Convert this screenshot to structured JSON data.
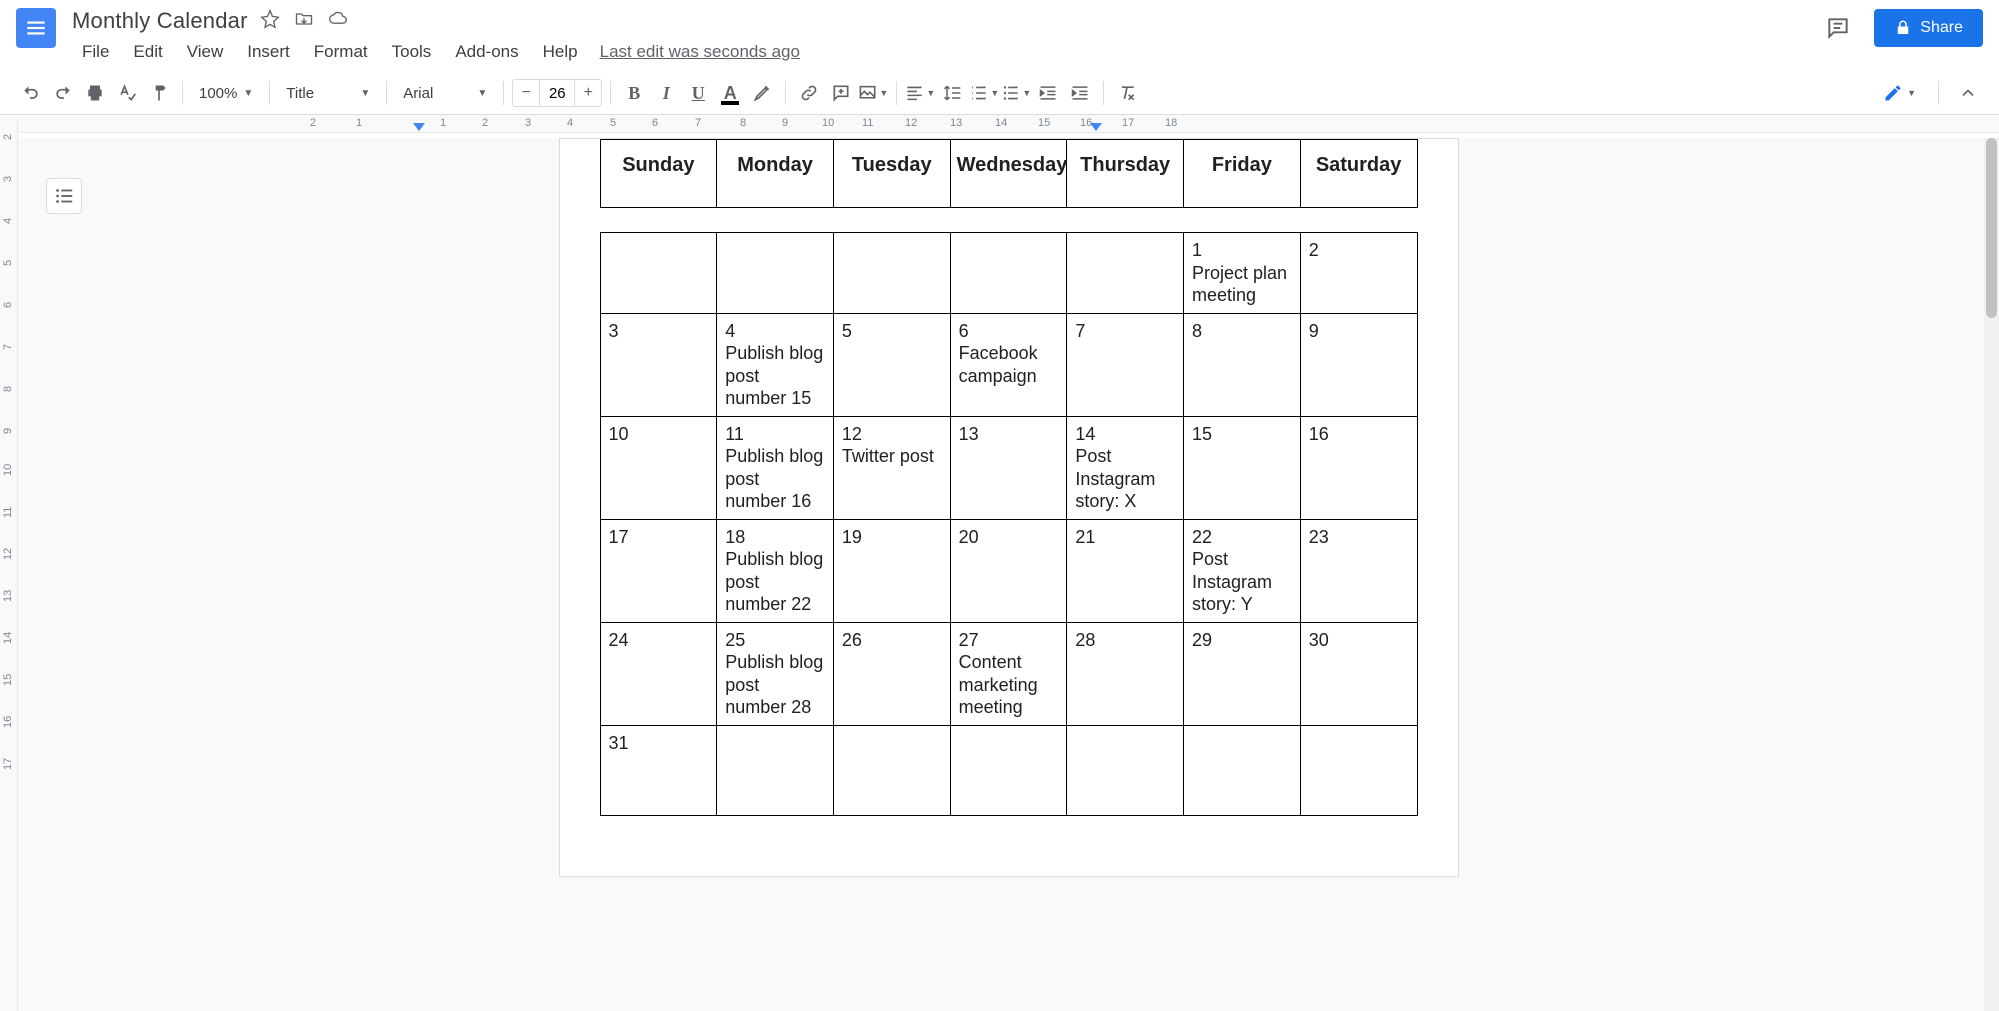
{
  "doc": {
    "title": "Monthly Calendar",
    "last_edit": "Last edit was seconds ago"
  },
  "menus": {
    "file": "File",
    "edit": "Edit",
    "view": "View",
    "insert": "Insert",
    "format": "Format",
    "tools": "Tools",
    "addons": "Add-ons",
    "help": "Help"
  },
  "share": {
    "label": "Share"
  },
  "toolbar": {
    "zoom": "100%",
    "style": "Title",
    "font": "Arial",
    "font_size": "26"
  },
  "hruler_ticks": [
    "2",
    "1",
    "1",
    "2",
    "3",
    "4",
    "5",
    "6",
    "7",
    "8",
    "9",
    "10",
    "11",
    "12",
    "13",
    "14",
    "15",
    "16",
    "17",
    "18"
  ],
  "vruler_ticks": [
    "2",
    "3",
    "4",
    "5",
    "6",
    "7",
    "8",
    "9",
    "10",
    "11",
    "12",
    "13",
    "14",
    "15",
    "16",
    "17"
  ],
  "calendar": {
    "days": [
      "Sunday",
      "Monday",
      "Tuesday",
      "Wednesday",
      "Thursday",
      "Friday",
      "Saturday"
    ],
    "weeks": [
      [
        {
          "num": "",
          "text": ""
        },
        {
          "num": "",
          "text": ""
        },
        {
          "num": "",
          "text": ""
        },
        {
          "num": "",
          "text": ""
        },
        {
          "num": "",
          "text": ""
        },
        {
          "num": "1",
          "text": "Project plan meeting"
        },
        {
          "num": "2",
          "text": ""
        }
      ],
      [
        {
          "num": "3",
          "text": ""
        },
        {
          "num": "4",
          "text": "Publish blog post number 15"
        },
        {
          "num": "5",
          "text": ""
        },
        {
          "num": "6",
          "text": "Facebook campaign"
        },
        {
          "num": "7",
          "text": ""
        },
        {
          "num": "8",
          "text": ""
        },
        {
          "num": "9",
          "text": ""
        }
      ],
      [
        {
          "num": "10",
          "text": ""
        },
        {
          "num": "11",
          "text": "Publish blog post number 16"
        },
        {
          "num": "12",
          "text": "Twitter post"
        },
        {
          "num": "13",
          "text": ""
        },
        {
          "num": "14",
          "text": "Post Instagram story: X"
        },
        {
          "num": "15",
          "text": ""
        },
        {
          "num": "16",
          "text": ""
        }
      ],
      [
        {
          "num": "17",
          "text": ""
        },
        {
          "num": "18",
          "text": "Publish blog post number 22"
        },
        {
          "num": "19",
          "text": ""
        },
        {
          "num": "20",
          "text": ""
        },
        {
          "num": "21",
          "text": ""
        },
        {
          "num": "22",
          "text": "Post Instagram story: Y"
        },
        {
          "num": "23",
          "text": ""
        }
      ],
      [
        {
          "num": "24",
          "text": ""
        },
        {
          "num": "25",
          "text": "Publish blog post number 28"
        },
        {
          "num": "26",
          "text": ""
        },
        {
          "num": "27",
          "text": "Content marketing meeting"
        },
        {
          "num": "28",
          "text": ""
        },
        {
          "num": "29",
          "text": ""
        },
        {
          "num": "30",
          "text": ""
        }
      ],
      [
        {
          "num": "31",
          "text": ""
        },
        {
          "num": "",
          "text": ""
        },
        {
          "num": "",
          "text": ""
        },
        {
          "num": "",
          "text": ""
        },
        {
          "num": "",
          "text": ""
        },
        {
          "num": "",
          "text": ""
        },
        {
          "num": "",
          "text": ""
        }
      ]
    ]
  }
}
